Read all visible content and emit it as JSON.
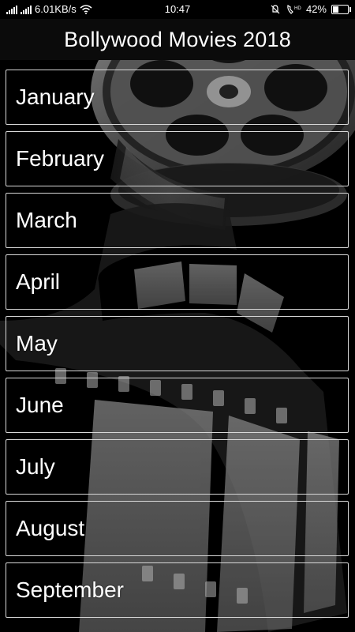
{
  "status_bar": {
    "speed": "6.01KB/s",
    "time": "10:47",
    "battery": "42%",
    "battery_level": 0.42,
    "icons": [
      "signal-icon",
      "wifi-icon",
      "mute-icon",
      "hd-call-icon",
      "battery-icon"
    ]
  },
  "header": {
    "title": "Bollywood Movies 2018"
  },
  "months": [
    {
      "label": "January"
    },
    {
      "label": "February"
    },
    {
      "label": "March"
    },
    {
      "label": "April"
    },
    {
      "label": "May"
    },
    {
      "label": "June"
    },
    {
      "label": "July"
    },
    {
      "label": "August"
    },
    {
      "label": "September"
    }
  ],
  "colors": {
    "background": "#000000",
    "text": "#ffffff",
    "item_border": "#d8d8d8"
  }
}
